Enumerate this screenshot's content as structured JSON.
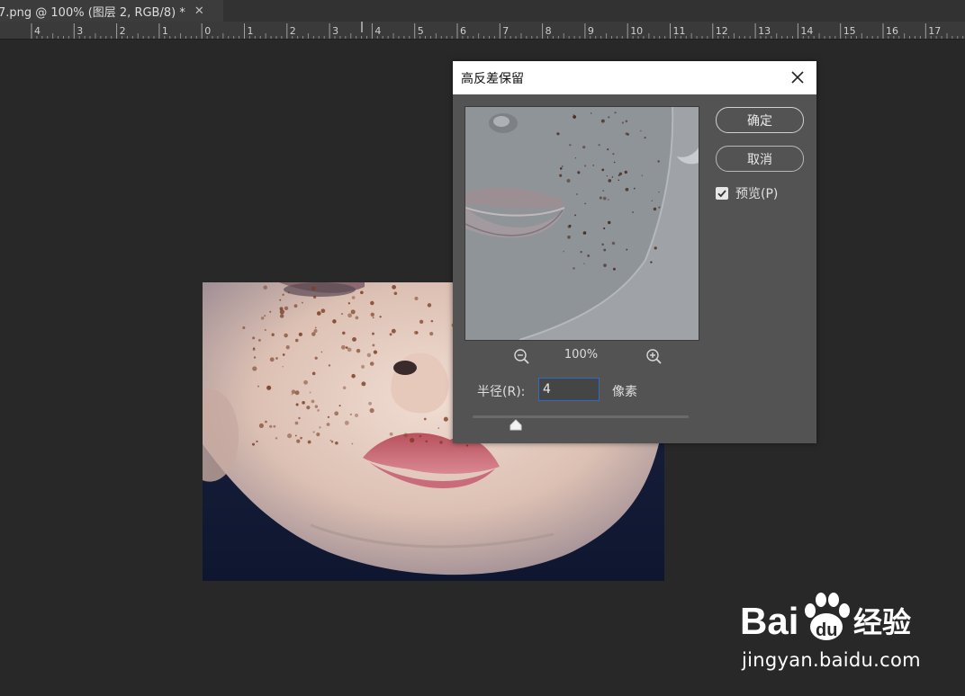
{
  "document_tab": {
    "title": "7.png @ 100% (图层 2, RGB/8) *",
    "close_glyph": "✕"
  },
  "ruler": {
    "labels": [
      "4",
      "3",
      "2",
      "1",
      "0",
      "1",
      "2",
      "3",
      "4",
      "5",
      "6",
      "7",
      "8",
      "9",
      "10",
      "11",
      "12",
      "13",
      "14",
      "15",
      "16",
      "17"
    ]
  },
  "dialog": {
    "title": "高反差保留",
    "ok_label": "确定",
    "cancel_label": "取消",
    "preview_label": "预览(P)",
    "preview_checked": true,
    "zoom_value": "100%",
    "radius_label": "半径(R):",
    "radius_value": "4",
    "unit_label": "像素",
    "slider_level_fraction": 0.2
  },
  "watermark": {
    "logo_text_latin": "Bai",
    "logo_text_latin2": "du",
    "logo_text_cn": "经验",
    "url": "jingyan.baidu.com"
  },
  "icons": {
    "close": "close-icon",
    "zoom_out": "zoom-out-icon",
    "zoom_in": "zoom-in-icon",
    "check": "checkmark-icon",
    "paw": "baidu-paw-icon"
  },
  "colors": {
    "workspace": "#282828",
    "dialog_bg": "#535353",
    "input_focus": "#2f6cc0"
  }
}
